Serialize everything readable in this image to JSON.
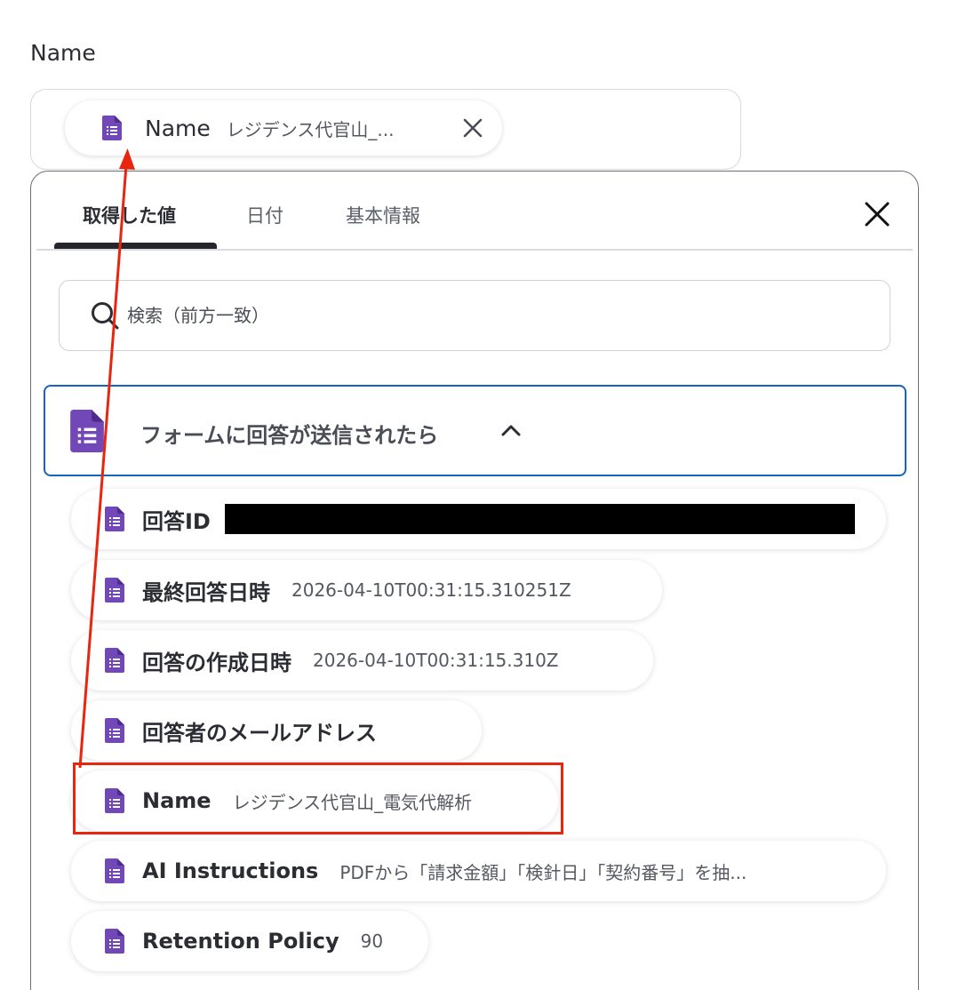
{
  "field": {
    "label": "Name",
    "chip": {
      "label": "Name",
      "value": "レジデンス代官山_..."
    }
  },
  "panel": {
    "tabs": [
      {
        "label": "取得した値",
        "active": true
      },
      {
        "label": "日付",
        "active": false
      },
      {
        "label": "基本情報",
        "active": false
      }
    ],
    "search": {
      "placeholder": "検索（前方一致）",
      "value": ""
    },
    "section": {
      "title": "フォームに回答が送信されたら",
      "expanded": true
    },
    "items": [
      {
        "label": "回答ID",
        "value": "",
        "redacted": true
      },
      {
        "label": "最終回答日時",
        "value": "2026-04-10T00:31:15.310251Z"
      },
      {
        "label": "回答の作成日時",
        "value": "2026-04-10T00:31:15.310Z"
      },
      {
        "label": "回答者のメールアドレス",
        "value": ""
      },
      {
        "label": "Name",
        "value": "レジデンス代官山_電気代解析",
        "highlighted": true
      },
      {
        "label": "AI Instructions",
        "value": "PDFから「請求金額」「検針日」「契約番号」を抽..."
      },
      {
        "label": "Retention Policy",
        "value": "90"
      }
    ]
  },
  "icons": {
    "form": "google-forms-icon",
    "close": "close-icon",
    "search": "search-icon",
    "chevron": "chevron-up-icon"
  },
  "colors": {
    "form_icon": "#7248b9",
    "section_border": "#1565c0",
    "annotation": "#e8260f"
  }
}
